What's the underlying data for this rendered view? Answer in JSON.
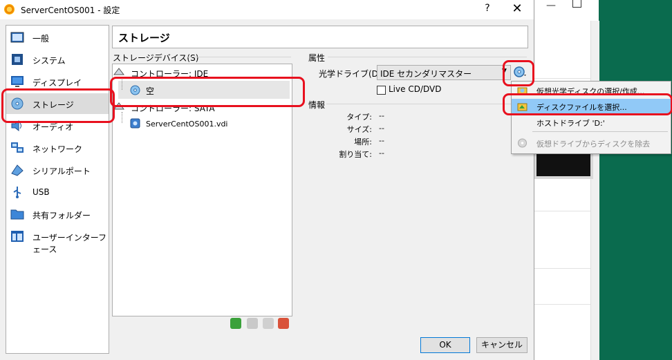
{
  "window": {
    "title": "ServerCentOS001 - 設定",
    "help": "?",
    "close": "✕"
  },
  "categories": [
    {
      "label": "一般",
      "icon": "general-icon"
    },
    {
      "label": "システム",
      "icon": "system-icon"
    },
    {
      "label": "ディスプレイ",
      "icon": "display-icon"
    },
    {
      "label": "ストレージ",
      "icon": "storage-icon",
      "selected": true
    },
    {
      "label": "オーディオ",
      "icon": "audio-icon"
    },
    {
      "label": "ネットワーク",
      "icon": "network-icon"
    },
    {
      "label": "シリアルポート",
      "icon": "serial-port-icon"
    },
    {
      "label": "USB",
      "icon": "usb-icon"
    },
    {
      "label": "共有フォルダー",
      "icon": "shared-folder-icon"
    },
    {
      "label": "ユーザーインターフェース",
      "icon": "user-interface-icon"
    }
  ],
  "page_title": "ストレージ",
  "storage": {
    "devices_label": "ストレージデバイス(S)",
    "tree": [
      {
        "label": "コントローラー: IDE",
        "icon": "ide-controller-icon"
      },
      {
        "label": "空",
        "icon": "optical-disc-icon"
      },
      {
        "label": "コントローラー: SATA",
        "icon": "sata-controller-icon"
      },
      {
        "label": "ServerCentOS001.vdi",
        "icon": "hard-disk-icon"
      }
    ]
  },
  "attributes": {
    "label": "属性",
    "drive_label": "光学ドライブ(D):",
    "drive_value": "IDE セカンダリマスター",
    "live_cd_label": "Live CD/DVD",
    "live_cd_checked": false
  },
  "info": {
    "label": "情報",
    "rows": [
      {
        "key": "タイプ:",
        "value": "--"
      },
      {
        "key": "サイズ:",
        "value": "--"
      },
      {
        "key": "場所:",
        "value": "--"
      },
      {
        "key": "割り当て:",
        "value": "--"
      }
    ]
  },
  "menu": {
    "items": [
      {
        "label": "仮想光学ディスクの選択/作成...",
        "icon": "optical-select-icon"
      },
      {
        "label": "ディスクファイルを選択...",
        "icon": "disk-file-icon",
        "highlighted": true
      },
      {
        "label": "ホストドライブ 'D:'",
        "icon": ""
      },
      {
        "label": "仮想ドライブからディスクを除去",
        "icon": "remove-disk-icon",
        "disabled": true
      }
    ]
  },
  "buttons": {
    "ok": "OK",
    "cancel": "キャンセル"
  },
  "colors": {
    "annotation": "#e8101e",
    "highlight": "#91c9f7",
    "selection": "#dcdcdc"
  }
}
